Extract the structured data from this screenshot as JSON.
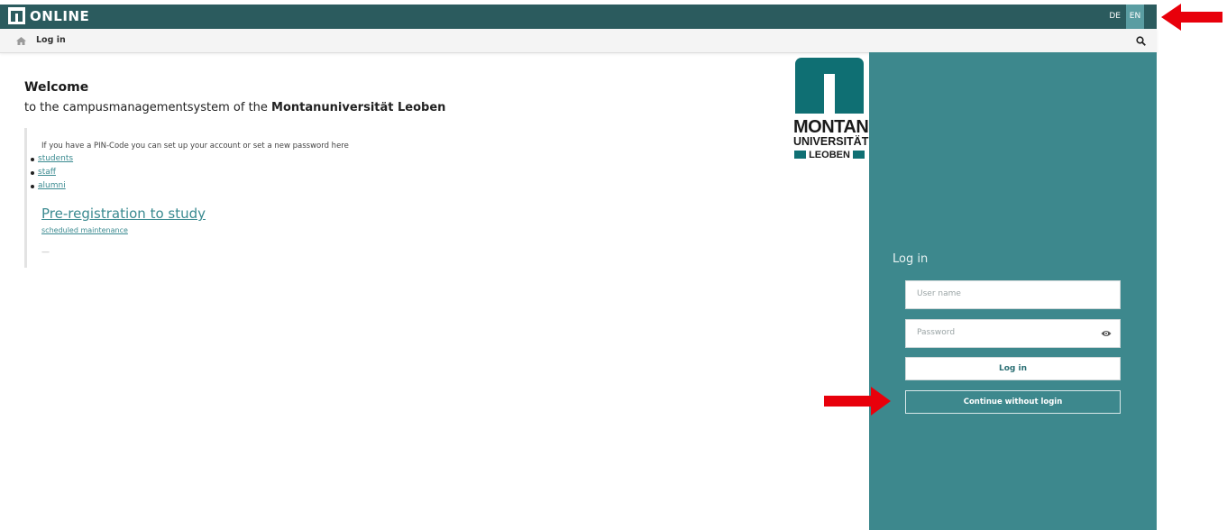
{
  "app": {
    "brand": "ONLINE"
  },
  "header": {
    "lang_de": "DE",
    "lang_en": "EN"
  },
  "breadcrumb": {
    "label": "Log in"
  },
  "welcome": {
    "title": "Welcome",
    "subtitle_prefix": "to the campusmanagementsystem of the ",
    "subtitle_bold": "Montanuniversität Leoben",
    "pin_text": "If you have a PIN-Code you can set up your account or set a new password here",
    "links": [
      "students",
      "staff",
      "alumni"
    ],
    "prereg": "Pre-registration to study",
    "maintenance": "scheduled maintenance",
    "dash": "—"
  },
  "logo": {
    "line1": "MONTAN",
    "line2": "UNIVERSITÄT",
    "line3": "LEOBEN"
  },
  "login": {
    "title": "Log in",
    "username_placeholder": "User name",
    "password_placeholder": "Password",
    "login_button": "Log in",
    "guest_button": "Continue without login"
  },
  "colors": {
    "topbar": "#2b5b5e",
    "panel": "#3d888d",
    "link": "#3a8a90",
    "logo": "#0f6f73",
    "annotation_arrow": "#e8000b"
  },
  "icons": [
    "home-icon",
    "search-icon",
    "eye-icon",
    "arrow-icon"
  ]
}
